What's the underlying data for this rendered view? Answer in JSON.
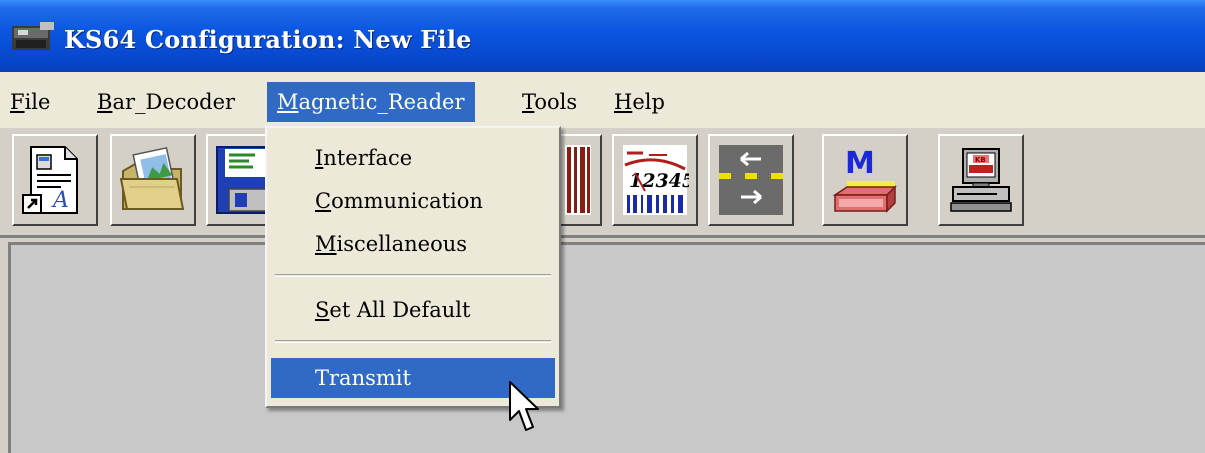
{
  "window": {
    "title": "KS64 Configuration: New File",
    "icon": "ks64-app-icon"
  },
  "menubar": {
    "items": [
      {
        "first": "F",
        "rest": "ile",
        "active": false
      },
      {
        "first": "B",
        "rest": "ar_Decoder",
        "active": false
      },
      {
        "first": "M",
        "rest": "agnetic_Reader",
        "active": true
      },
      {
        "first": "T",
        "rest": "ools",
        "active": false
      },
      {
        "first": "H",
        "rest": "elp",
        "active": false
      }
    ]
  },
  "toolbar": {
    "buttons": [
      {
        "icon": "new-file-shortcut-icon"
      },
      {
        "icon": "open-folder-icon"
      },
      {
        "icon": "save-floppy-icon"
      },
      {
        "icon": "barcode-symbology-icon"
      },
      {
        "icon": "barcode-12345-icon"
      },
      {
        "icon": "transfer-arrows-icon"
      },
      {
        "icon": "magnetic-reader-icon"
      },
      {
        "icon": "terminal-computer-icon"
      }
    ]
  },
  "dropdown": {
    "items": [
      {
        "first": "I",
        "rest": "nterface",
        "selected": false
      },
      {
        "first": "C",
        "rest": "ommunication",
        "selected": false
      },
      {
        "first": "M",
        "rest": "iscellaneous",
        "selected": false
      },
      {
        "first": "S",
        "rest": "et All Default",
        "selected": false
      },
      {
        "first": "",
        "rest": "Transmit",
        "selected": true
      }
    ]
  },
  "colors": {
    "title_bar": "#0a55e0",
    "menu_highlight": "#316ac5",
    "menu_background": "#ece9d8",
    "toolbar_background": "#d4d0c8",
    "client_background": "#c8c8c8"
  }
}
